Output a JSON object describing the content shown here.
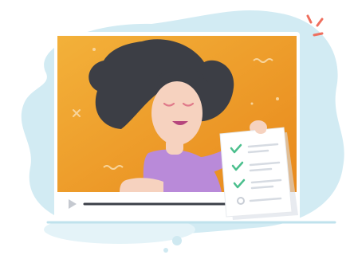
{
  "illustration": {
    "subject": "woman-presenting-checklist-in-video-player",
    "icons": {
      "play": "play-icon",
      "checklist": "checklist-document-icon",
      "sparkle": "sparkle-icon"
    },
    "player": {
      "progress": 0.74
    },
    "checklist": {
      "checked_count": 3,
      "unchecked_count": 1
    },
    "colors": {
      "blob": "#cfe9f1",
      "video_bg": "#f2a528",
      "video_bg_dark": "#e8891c",
      "hair": "#3c3e45",
      "skin": "#f6d2bf",
      "shirt": "#b98ad9",
      "check": "#4bbf8d",
      "progress": "#3b3f48",
      "accent": "#ef6f5e",
      "frame": "#ffffff"
    }
  }
}
